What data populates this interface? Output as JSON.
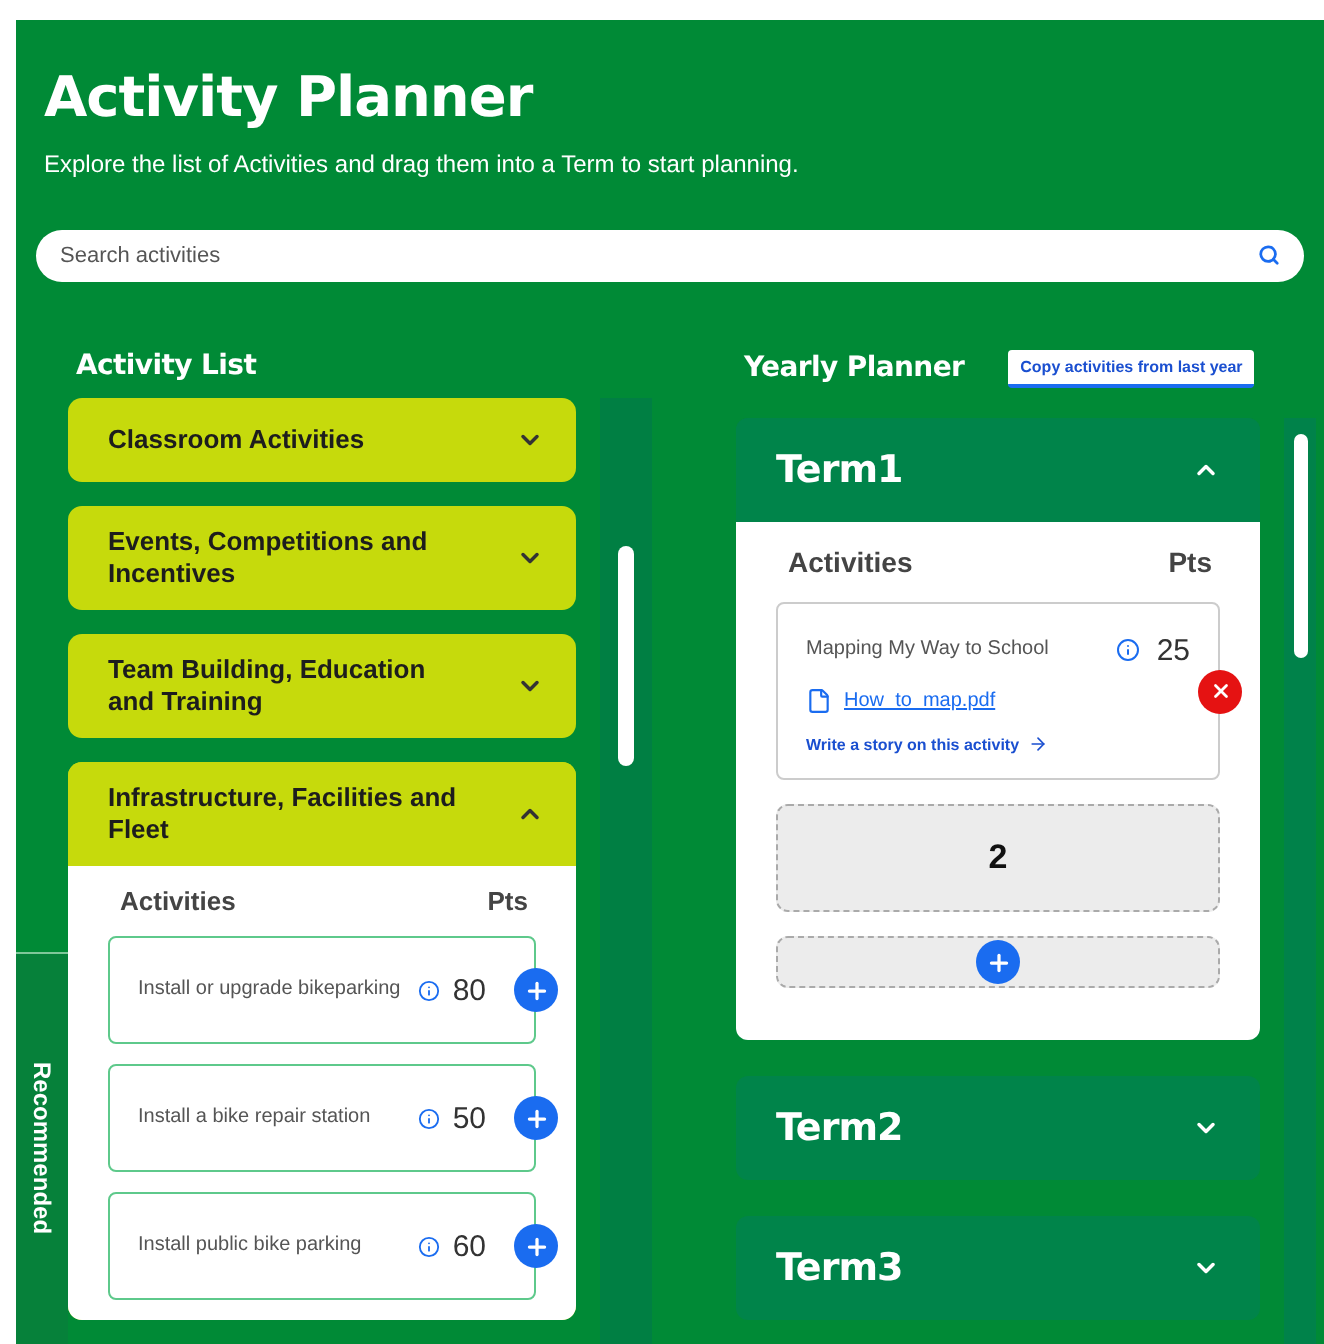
{
  "header": {
    "title": "Activity Planner",
    "subtitle": "Explore the list of Activities and drag them into a Term to start planning."
  },
  "search": {
    "placeholder": "Search activities"
  },
  "activity_list": {
    "title": "Activity List",
    "recommended_tab": "Recommended",
    "categories": [
      {
        "name": "Classroom Activities",
        "expanded": false
      },
      {
        "name": "Events, Competitions and Incentives",
        "expanded": false
      },
      {
        "name": "Team Building, Education and Training",
        "expanded": false
      },
      {
        "name": "Infrastructure, Facilities and Fleet",
        "expanded": true,
        "columns": [
          "Activities",
          "Pts"
        ],
        "activities": [
          {
            "name": "Install or upgrade bikeparking",
            "points": "80"
          },
          {
            "name": "Install a bike repair station",
            "points": "50"
          },
          {
            "name": "Install public bike parking",
            "points": "60"
          }
        ]
      }
    ]
  },
  "yearly_planner": {
    "title": "Yearly Planner",
    "copy_button": "Copy activities from last year",
    "terms": [
      {
        "name": "Term1",
        "expanded": true,
        "columns": [
          "Activities",
          "Pts"
        ],
        "activities": [
          {
            "name": "Mapping My Way to School",
            "points": "25",
            "attachment": "How_to_map.pdf",
            "story_link": "Write a story on this activity"
          }
        ],
        "placeholder_slot": "2"
      },
      {
        "name": "Term2",
        "expanded": false
      },
      {
        "name": "Term3",
        "expanded": false
      }
    ]
  }
}
